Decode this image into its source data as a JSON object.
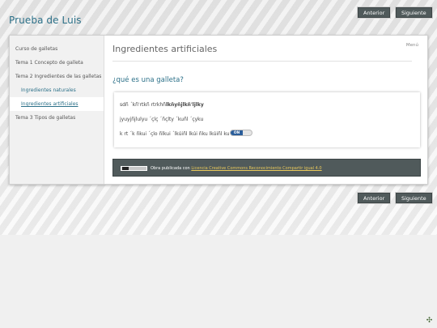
{
  "header": {
    "site_title": "Prueba de Luis",
    "prev_label": "Anterior",
    "next_label": "Siguiente"
  },
  "sidebar": {
    "items": [
      {
        "label": "Curso de galletas"
      },
      {
        "label": "Tema 1 Concepto de galleta"
      },
      {
        "label": "Tema 2 Ingredientes de las galletas"
      },
      {
        "label": "Ingredientes naturales"
      },
      {
        "label": "Ingredientes artificiales"
      },
      {
        "label": "Tema 3 Tipos de galletas"
      }
    ]
  },
  "main": {
    "page_title": "Ingredientes artificiales",
    "menu_label": "Menú",
    "section_title": "¿qué es una galleta?",
    "box_lines": [
      {
        "text": "sdñ ´kñ'rtkñ rtrkhñ",
        "bold": "lkñyñjlkñ'ljlky"
      },
      {
        "text": "jyuyjñjlulyu ´çlç ´ñçlty ´kuñl ´çyku"
      },
      {
        "text": "k rt ´k ñkui ´çlo ñlkui ´lkúiñl lkúi ñku lkúiñl  ku"
      }
    ],
    "toggle_label": "ON"
  },
  "footer": {
    "license_prefix": "Obra publicada con",
    "license_link": "Licencia Creative Commons Reconocimiento Compartir igual 4.0",
    "prev_label": "Anterior",
    "next_label": "Siguiente"
  },
  "colors": {
    "accent": "#2d7189",
    "nav_button": "#505a5b",
    "toggle_on": "#2a5d9a",
    "license_link": "#e8c85a"
  },
  "icons": {
    "badge": "cc-by-sa-badge",
    "tool": "puzzle-icon"
  }
}
